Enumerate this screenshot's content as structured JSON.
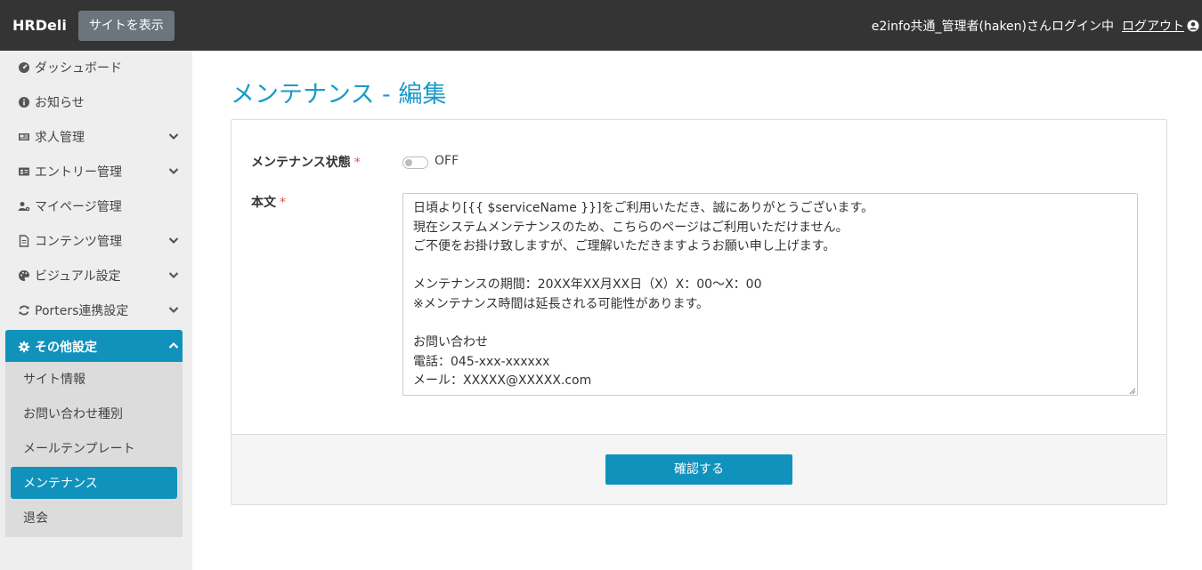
{
  "header": {
    "brand": "HRDeli",
    "site_button": "サイトを表示",
    "user_text": "e2info共通_管理者(haken)さんログイン中",
    "logout": "ログアウト"
  },
  "sidebar": {
    "items": [
      {
        "label": "ダッシュボード",
        "icon": "dashboard-icon"
      },
      {
        "label": "お知らせ",
        "icon": "info-icon"
      },
      {
        "label": "求人管理",
        "icon": "newspaper-icon"
      },
      {
        "label": "エントリー管理",
        "icon": "id-card-icon"
      },
      {
        "label": "マイページ管理",
        "icon": "user-cog-icon"
      },
      {
        "label": "コンテンツ管理",
        "icon": "file-icon"
      },
      {
        "label": "ビジュアル設定",
        "icon": "palette-icon"
      },
      {
        "label": "Porters連携設定",
        "icon": "sync-icon"
      },
      {
        "label": "その他設定",
        "icon": "gear-icon"
      }
    ],
    "sub_items": [
      "サイト情報",
      "お問い合わせ種別",
      "メールテンプレート",
      "メンテナンス",
      "退会"
    ]
  },
  "main": {
    "title": "メンテナンス - 編集",
    "status_label": "メンテナンス状態",
    "required_mark": "*",
    "toggle_state": "OFF",
    "body_label": "本文",
    "body_text": "日頃より[{{ $serviceName }}]をご利用いただき、誠にありがとうございます。\n現在システムメンテナンスのため、こちらのページはご利用いただけません。\nご不便をお掛け致しますが、ご理解いただきますようお願い申し上げます。\n\nメンテナンスの期間：20XX年XX月XX日（X）X：00〜X：00\n※メンテナンス時間は延長される可能性があります。\n\nお問い合わせ\n電話：045-xxx-xxxxxx\nメール：XXXXX@XXXXX.com",
    "confirm_button": "確認する"
  },
  "colors": {
    "accent": "#1192bd",
    "title": "#1a9bc8",
    "topbar": "#343434",
    "required": "#d9534f"
  }
}
